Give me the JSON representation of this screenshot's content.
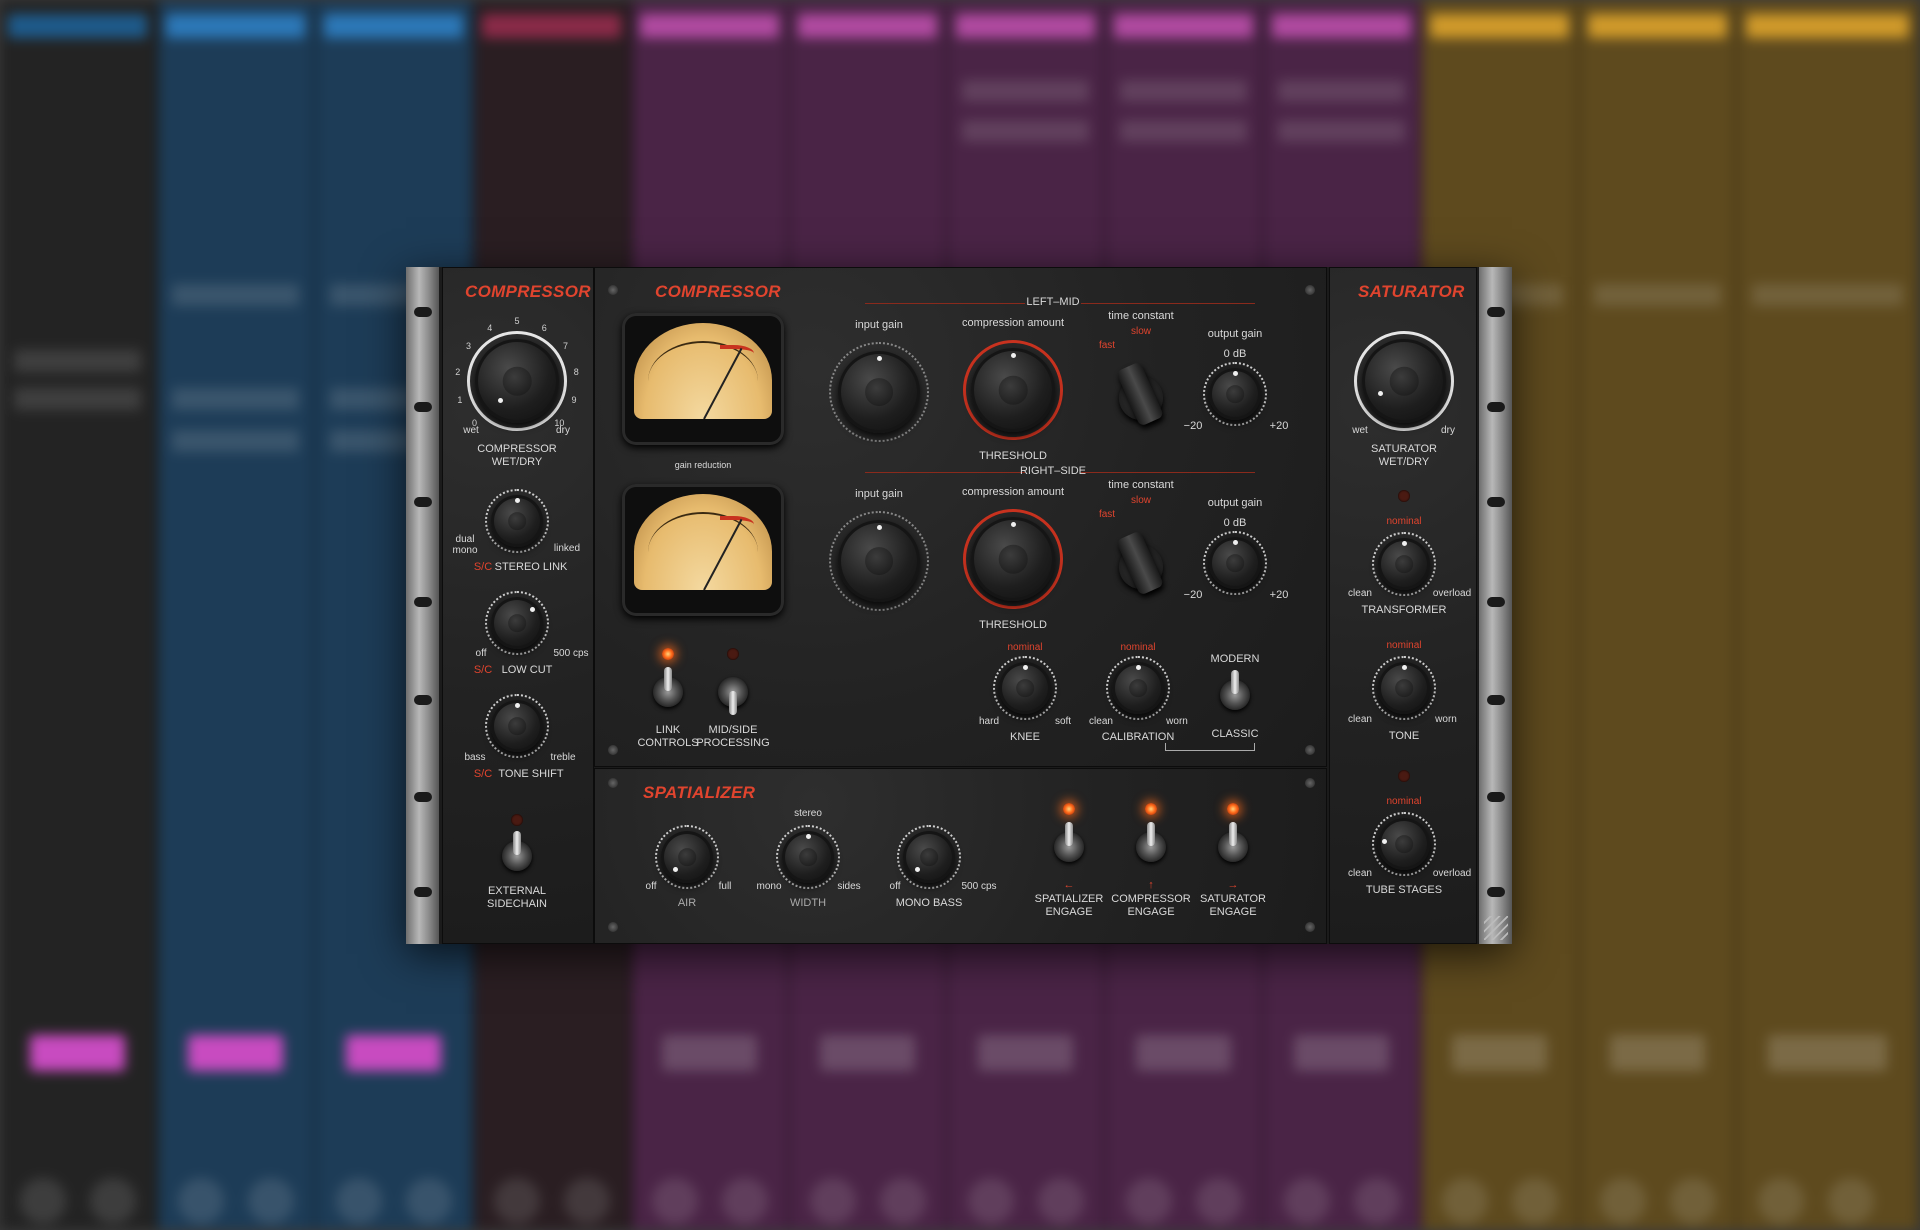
{
  "left_panel": {
    "title": "COMPRESSOR",
    "wetdry": {
      "label_line1": "COMPRESSOR",
      "label_line2": "WET/DRY",
      "min": "wet",
      "max": "dry",
      "ticks": [
        "0",
        "1",
        "2",
        "3",
        "4",
        "5",
        "6",
        "7",
        "8",
        "9",
        "10"
      ]
    },
    "stereo_link": {
      "prefix": "S/C",
      "label": "STEREO LINK",
      "min_line1": "dual",
      "min_line2": "mono",
      "max": "linked"
    },
    "low_cut": {
      "prefix": "S/C",
      "label": "LOW CUT",
      "min": "off",
      "max": "500 cps"
    },
    "tone_shift": {
      "prefix": "S/C",
      "label": "TONE SHIFT",
      "min": "bass",
      "max": "treble"
    },
    "external_sidechain": {
      "label_line1": "EXTERNAL",
      "label_line2": "SIDECHAIN"
    }
  },
  "compressor": {
    "title": "COMPRESSOR",
    "meter_caption": "gain reduction",
    "left_mid": {
      "section": "LEFT–MID",
      "input_gain": "input gain",
      "compression_amount": "compression amount",
      "threshold": "THRESHOLD",
      "time_constant": "time constant",
      "fast": "fast",
      "slow": "slow",
      "output_gain": "output gain",
      "zero_db": "0 dB",
      "min": "−20",
      "max": "+20"
    },
    "right_side": {
      "section": "RIGHT–SIDE",
      "input_gain": "input gain",
      "compression_amount": "compression amount",
      "threshold": "THRESHOLD",
      "time_constant": "time constant",
      "fast": "fast",
      "slow": "slow",
      "output_gain": "output gain",
      "zero_db": "0 dB",
      "min": "−20",
      "max": "+20"
    },
    "link_controls": {
      "line1": "LINK",
      "line2": "CONTROLS"
    },
    "mid_side": {
      "line1": "MID/SIDE",
      "line2": "PROCESSING"
    },
    "knee": {
      "label": "KNEE",
      "nominal": "nominal",
      "min": "hard",
      "max": "soft"
    },
    "calibration": {
      "label": "CALIBRATION",
      "nominal": "nominal",
      "min": "clean",
      "max": "worn"
    },
    "mode": {
      "top": "MODERN",
      "bottom": "CLASSIC"
    }
  },
  "spatializer": {
    "title": "SPATIALIZER",
    "air": {
      "label": "AIR",
      "min": "off",
      "max": "full"
    },
    "width": {
      "label": "WIDTH",
      "top": "stereo",
      "min": "mono",
      "max": "sides"
    },
    "mono_bass": {
      "label": "MONO BASS",
      "min": "off",
      "max": "500 cps"
    },
    "spatializer_engage": {
      "line1": "SPATIALIZER",
      "line2": "ENGAGE",
      "arrow": "←"
    },
    "compressor_engage": {
      "line1": "COMPRESSOR",
      "line2": "ENGAGE",
      "arrow": "↑"
    },
    "saturator_engage": {
      "line1": "SATURATOR",
      "line2": "ENGAGE",
      "arrow": "→"
    }
  },
  "saturator": {
    "title": "SATURATOR",
    "wetdry": {
      "label_line1": "SATURATOR",
      "label_line2": "WET/DRY",
      "min": "wet",
      "max": "dry"
    },
    "transformer": {
      "label": "TRANSFORMER",
      "nominal": "nominal",
      "min": "clean",
      "max": "overload"
    },
    "tone": {
      "label": "TONE",
      "nominal": "nominal",
      "min": "clean",
      "max": "worn"
    },
    "tube_stages": {
      "label": "TUBE STAGES",
      "nominal": "nominal",
      "min": "clean",
      "max": "overload"
    }
  },
  "colors": {
    "accent_red": "#e0442e",
    "led_on": "#ff6a1a",
    "meter_face": "#e7bb6e"
  }
}
